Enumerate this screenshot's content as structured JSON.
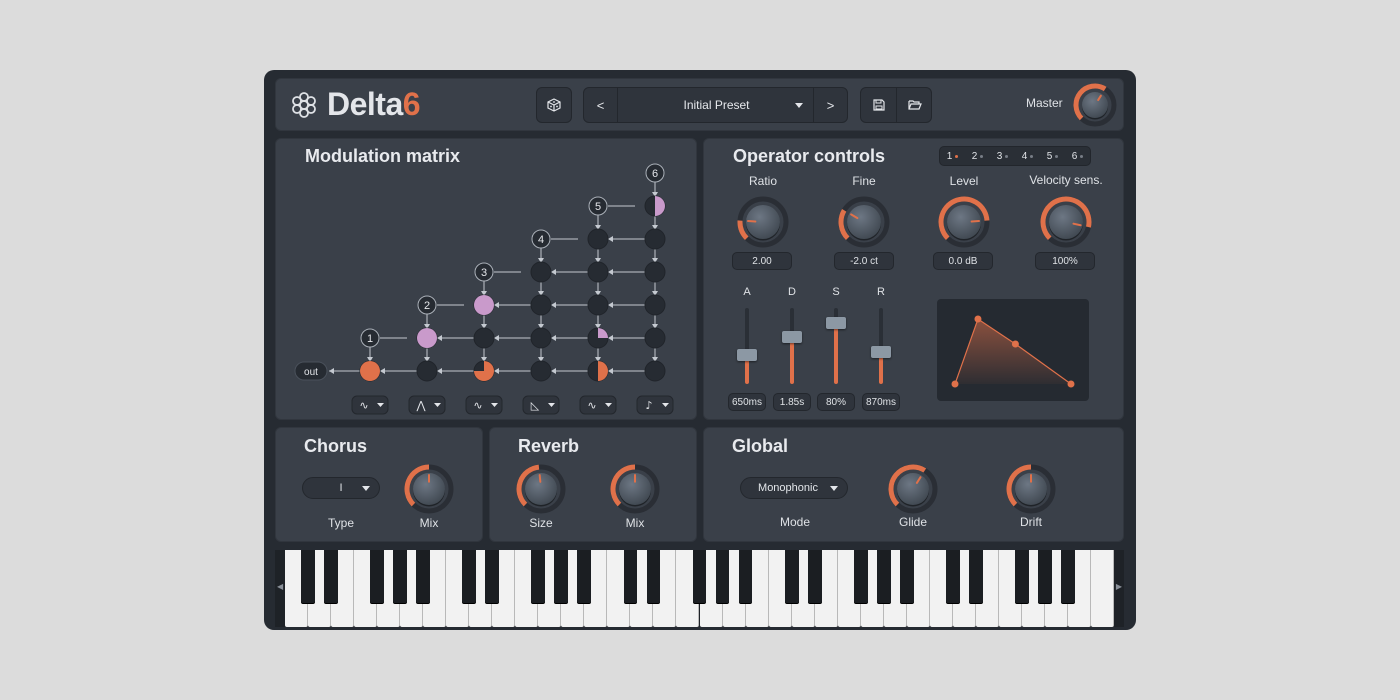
{
  "app": {
    "name_main": "Delta",
    "name_accent": "6",
    "colors": {
      "accent": "#e0714a",
      "mod": "#c99acb",
      "node": "#262b32",
      "panel": "#3a4049"
    }
  },
  "header": {
    "preset_name": "Initial Preset",
    "prev_label": "<",
    "next_label": ">",
    "master_label": "Master",
    "master_value": 0.62,
    "icons": [
      "flower-logo-icon",
      "dice-icon",
      "chevron-down-icon",
      "floppy-icon",
      "folder-open-icon"
    ]
  },
  "matrix": {
    "title": "Modulation matrix",
    "out_label": "out",
    "operators": [
      "1",
      "2",
      "3",
      "4",
      "5",
      "6"
    ],
    "waveforms": [
      "∿",
      "⋀",
      "∿",
      "◺",
      "∿",
      "♪"
    ],
    "feedback_levels": {
      "op1": 1.0,
      "op2": 1.0,
      "op3": 1.0,
      "op6": 0.5
    },
    "mod_amounts": {
      "r2c5": 0.25,
      "r1c3": 0.75,
      "r1c5": 0.5
    }
  },
  "operator": {
    "title": "Operator controls",
    "tabs": [
      "1",
      "2",
      "3",
      "4",
      "5",
      "6"
    ],
    "active_tab": 0,
    "knobs": [
      {
        "label": "Ratio",
        "value_text": "2.00",
        "value": 0.18
      },
      {
        "label": "Fine",
        "value_text": "-2.0 ct",
        "value": 0.28
      },
      {
        "label": "Level",
        "value_text": "0.0 dB",
        "value": 0.82
      },
      {
        "label": "Velocity sens.",
        "value_text": "100%",
        "value": 0.88
      }
    ],
    "envelope": [
      {
        "label": "A",
        "value_text": "650ms",
        "value": 0.38
      },
      {
        "label": "D",
        "value_text": "1.85s",
        "value": 0.62
      },
      {
        "label": "S",
        "value_text": "80%",
        "value": 0.8
      },
      {
        "label": "R",
        "value_text": "870ms",
        "value": 0.42
      }
    ]
  },
  "chorus": {
    "title": "Chorus",
    "type_value": "I",
    "type_label": "Type",
    "mix_label": "Mix",
    "mix_value": 0.5
  },
  "reverb": {
    "title": "Reverb",
    "size_label": "Size",
    "size_value": 0.48,
    "mix_label": "Mix",
    "mix_value": 0.5
  },
  "global": {
    "title": "Global",
    "mode_value": "Monophonic",
    "mode_label": "Mode",
    "glide_label": "Glide",
    "glide_value": 0.62,
    "drift_label": "Drift",
    "drift_value": 0.5
  },
  "keyboard": {
    "white_key_count": 36
  }
}
